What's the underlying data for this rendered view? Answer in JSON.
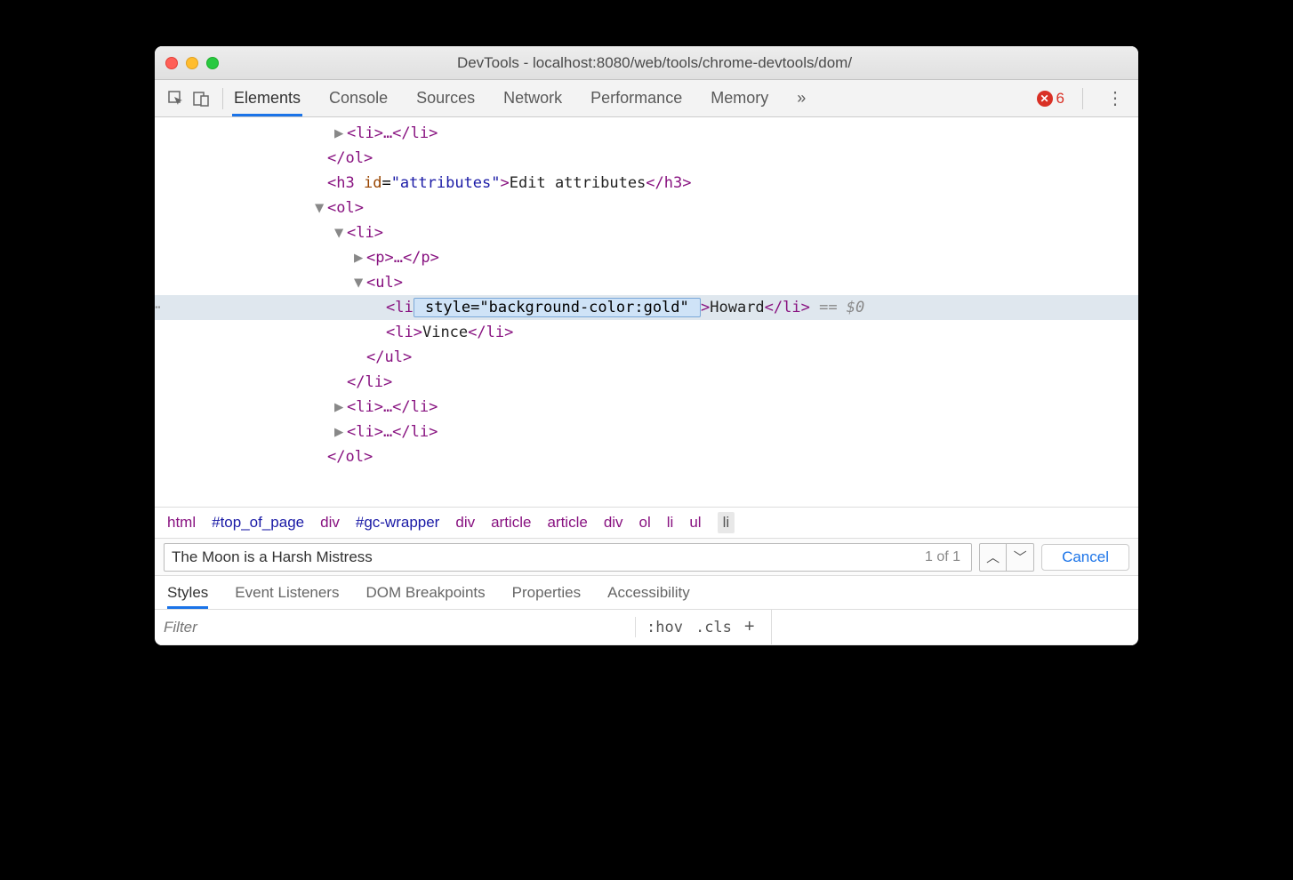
{
  "window": {
    "title": "DevTools - localhost:8080/web/tools/chrome-devtools/dom/"
  },
  "toolbar": {
    "tabs": [
      "Elements",
      "Console",
      "Sources",
      "Network",
      "Performance",
      "Memory"
    ],
    "active_tab": "Elements",
    "overflow_glyph": "»",
    "error_count": "6"
  },
  "dom": {
    "lines": [
      {
        "indent": 10,
        "caret": "▶",
        "html": "<li>…</li>"
      },
      {
        "indent": 9,
        "caret": "",
        "html_close": "</ol>"
      },
      {
        "indent": 9,
        "caret": "",
        "h3_open": "<h3 ",
        "attr_name": "id",
        "attr_eq": "=",
        "attr_val": "\"attributes\"",
        "h3_mid": ">",
        "text": "Edit attributes",
        "h3_close": "</h3>"
      },
      {
        "indent": 9,
        "caret": "▼",
        "html": "<ol>"
      },
      {
        "indent": 10,
        "caret": "▼",
        "html": "<li>"
      },
      {
        "indent": 11,
        "caret": "▶",
        "html": "<p>…</p>"
      },
      {
        "indent": 11,
        "caret": "▼",
        "html": "<ul>"
      },
      {
        "indent": 12,
        "caret": "",
        "selected": true,
        "li_open": "<li",
        "edit_attr": " style=\"background-color:gold\" ",
        "li_mid": ">",
        "text": "Howard",
        "li_close": "</li>",
        "suffix": " == $0"
      },
      {
        "indent": 12,
        "caret": "",
        "li_open": "<li",
        "li_mid": ">",
        "text": "Vince",
        "li_close": "</li>"
      },
      {
        "indent": 11,
        "caret": "",
        "html_close": "</ul>"
      },
      {
        "indent": 10,
        "caret": "",
        "html_close": "</li>"
      },
      {
        "indent": 10,
        "caret": "▶",
        "html": "<li>…</li>"
      },
      {
        "indent": 10,
        "caret": "▶",
        "html": "<li>…</li>"
      },
      {
        "indent": 9,
        "caret": "",
        "html_close": "</ol>"
      }
    ]
  },
  "breadcrumb": {
    "items": [
      {
        "label": "html"
      },
      {
        "label": "#top_of_page",
        "is_id": true
      },
      {
        "label": "div"
      },
      {
        "label": "#gc-wrapper",
        "is_id": true
      },
      {
        "label": "div"
      },
      {
        "label": "article"
      },
      {
        "label": "article"
      },
      {
        "label": "div"
      },
      {
        "label": "ol"
      },
      {
        "label": "li"
      },
      {
        "label": "ul"
      },
      {
        "label": "li",
        "selected": true
      }
    ]
  },
  "search": {
    "value": "The Moon is a Harsh Mistress",
    "count": "1 of 1",
    "cancel": "Cancel"
  },
  "subtabs": {
    "items": [
      "Styles",
      "Event Listeners",
      "DOM Breakpoints",
      "Properties",
      "Accessibility"
    ],
    "active": "Styles"
  },
  "filter": {
    "placeholder": "Filter",
    "hov": ":hov",
    "cls": ".cls",
    "plus": "+"
  }
}
